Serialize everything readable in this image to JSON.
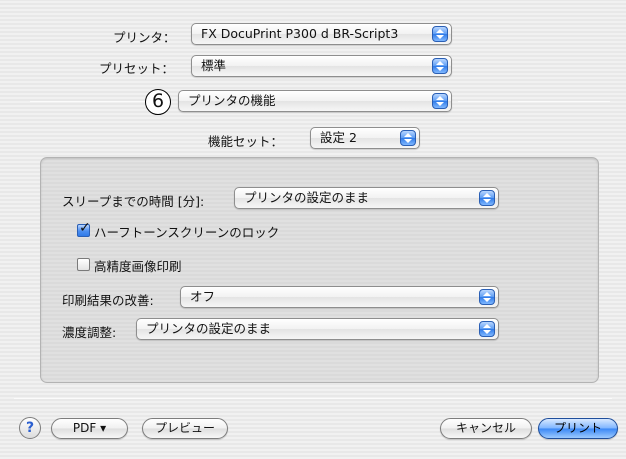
{
  "printer": {
    "label": "プリンタ：",
    "value": "FX DocuPrint P300 d BR-Script3"
  },
  "preset": {
    "label": "プリセット：",
    "value": "標準"
  },
  "annotation_number": "6",
  "panel": {
    "value": "プリンタの機能"
  },
  "feature_set": {
    "label": "機能セット：",
    "value": "設定 2"
  },
  "options": {
    "sleep_time": {
      "label": "スリープまでの時間 [分]:",
      "value": "プリンタの設定のまま"
    },
    "halftone_lock": {
      "label": "ハーフトーンスクリーンのロック",
      "checked": true
    },
    "high_precision": {
      "label": "高精度画像印刷",
      "checked": false
    },
    "print_improve": {
      "label": "印刷結果の改善:",
      "value": "オフ"
    },
    "density": {
      "label": "濃度調整:",
      "value": "プリンタの設定のまま"
    }
  },
  "footer": {
    "help": "?",
    "pdf": "PDF ▾",
    "preview": "プレビュー",
    "cancel": "キャンセル",
    "print": "プリント"
  }
}
